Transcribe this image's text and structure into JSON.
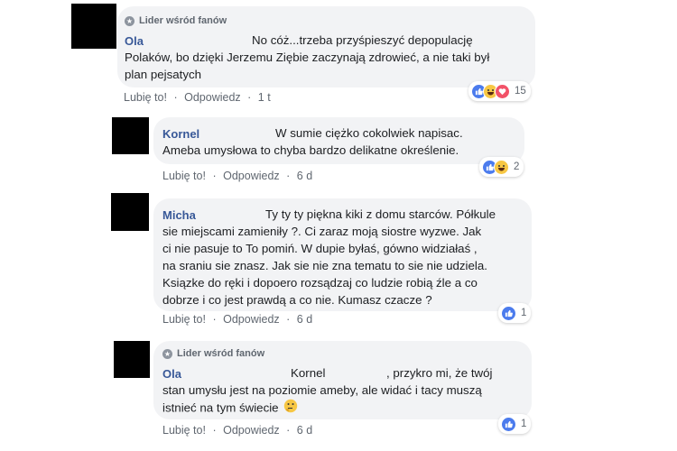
{
  "comments": [
    {
      "badge": "Lider wśród fanów",
      "author": "Ola",
      "lines": [
        "No cóż...trzeba przyśpieszyć depopulację",
        "Polaków, bo dzięki Jerzemu Ziębie zaczynają zdrowieć, a nie taki był",
        "plan pejsatych"
      ],
      "like": "Lubię to!",
      "reply": "Odpowiedz",
      "time": "1 t",
      "reactions": [
        "like",
        "haha",
        "love"
      ],
      "reaction_count": "15"
    },
    {
      "author": "Kornel",
      "lines": [
        "W sumie ciężko cokolwiek napisac.",
        "Ameba umysłowa to chyba bardzo delikatne określenie."
      ],
      "like": "Lubię to!",
      "reply": "Odpowiedz",
      "time": "6 d",
      "reactions": [
        "like",
        "haha"
      ],
      "reaction_count": "2"
    },
    {
      "author": "Micha",
      "lines": [
        "Ty ty ty piękna kiki z domu starców. Półkule",
        "sie miejscami zamieniły ?. Ci zaraz moją siostre wyzwe. Jak",
        "ci nie pasuje to To pomiń. W dupie byłaś, gówno widziałaś ,",
        "na sraniu sie znasz. Jak sie nie zna tematu to sie nie udziela.",
        "Ksiązke do ręki i dopoero rozsądzaj co ludzie robią źle a co",
        "dobrze i co jest prawdą a co nie. Kumasz czacze ?"
      ],
      "like": "Lubię to!",
      "reply": "Odpowiedz",
      "time": "6 d",
      "reactions": [
        "like"
      ],
      "reaction_count": "1"
    },
    {
      "badge": "Lider wśród fanów",
      "author": "Ola",
      "mention": "Kornel",
      "lines": [
        ", przykro mi, że twój",
        "stan umysłu jest na poziomie ameby, ale widać i tacy muszą",
        "istnieć na tym świecie"
      ],
      "emoji": "thinking-emoji",
      "like": "Lubię to!",
      "reply": "Odpowiedz",
      "time": "6 d",
      "reactions": [
        "like"
      ],
      "reaction_count": "1"
    }
  ],
  "separator": "·",
  "colors": {
    "link": "#385898",
    "bubble": "#f2f3f5",
    "like": "#4b7bed",
    "haha": "#f7c744",
    "love": "#f25268"
  }
}
